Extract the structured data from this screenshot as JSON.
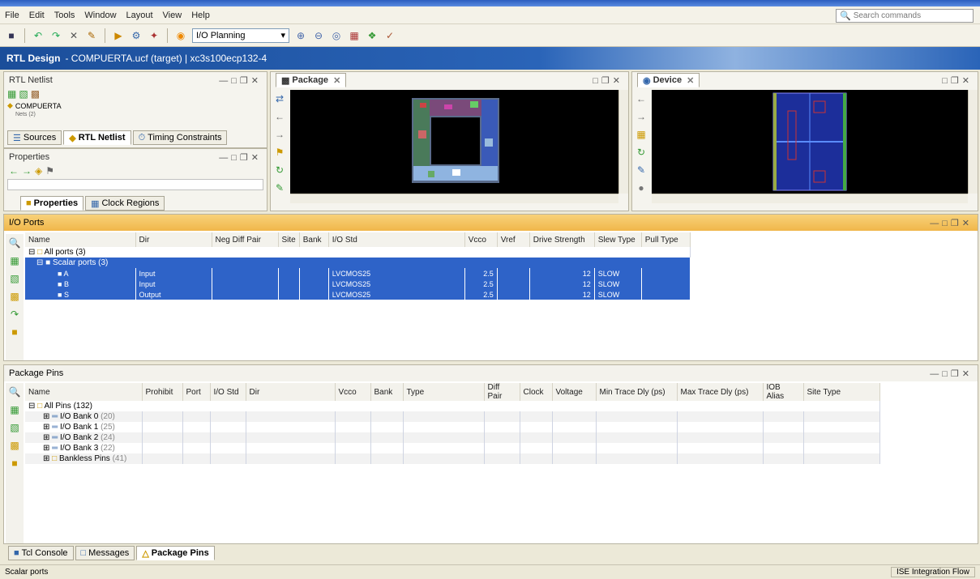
{
  "menu": [
    "File",
    "Edit",
    "Tools",
    "Window",
    "Layout",
    "View",
    "Help"
  ],
  "search_placeholder": "Search commands",
  "toolbar": {
    "layout_value": "I/O Planning"
  },
  "title": {
    "main": "RTL Design",
    "subtitle": "- COMPUERTA.ucf (target) | xc3s100ecp132-4"
  },
  "rtl_netlist": {
    "header": "RTL Netlist",
    "root_item": "COMPUERTA",
    "sub_item": "Nets (2)",
    "tabs": [
      "Sources",
      "RTL Netlist",
      "Timing Constraints"
    ]
  },
  "properties": {
    "header": "Properties",
    "tabs": [
      "Properties",
      "Clock Regions"
    ]
  },
  "package_view": {
    "tab": "Package"
  },
  "device_view": {
    "tab": "Device"
  },
  "io_ports": {
    "header": "I/O Ports",
    "columns": [
      "Name",
      "Dir",
      "Neg Diff Pair",
      "Site",
      "Bank",
      "I/O Std",
      "Vcco",
      "Vref",
      "Drive Strength",
      "Slew Type",
      "Pull Type"
    ],
    "root": "All ports (3)",
    "group": "Scalar ports (3)",
    "rows": [
      {
        "name": "A",
        "dir": "Input",
        "std": "LVCMOS25",
        "vcco": "2.5",
        "drive": "12",
        "slew": "SLOW"
      },
      {
        "name": "B",
        "dir": "Input",
        "std": "LVCMOS25",
        "vcco": "2.5",
        "drive": "12",
        "slew": "SLOW"
      },
      {
        "name": "S",
        "dir": "Output",
        "std": "LVCMOS25",
        "vcco": "2.5",
        "drive": "12",
        "slew": "SLOW"
      }
    ]
  },
  "package_pins": {
    "header": "Package Pins",
    "columns": [
      "Name",
      "Prohibit",
      "Port",
      "I/O Std",
      "Dir",
      "Vcco",
      "Bank",
      "Type",
      "Diff Pair",
      "Clock",
      "Voltage",
      "Min Trace Dly (ps)",
      "Max Trace Dly (ps)",
      "IOB Alias",
      "Site Type"
    ],
    "root": "All Pins (132)",
    "rows": [
      {
        "name": "I/O Bank 0",
        "count": "(20)"
      },
      {
        "name": "I/O Bank 1",
        "count": "(25)"
      },
      {
        "name": "I/O Bank 2",
        "count": "(24)"
      },
      {
        "name": "I/O Bank 3",
        "count": "(22)"
      },
      {
        "name": "Bankless Pins",
        "count": "(41)"
      }
    ]
  },
  "bottom_tabs": [
    "Tcl Console",
    "Messages",
    "Package Pins"
  ],
  "status": {
    "left": "Scalar ports",
    "right": "ISE Integration Flow"
  }
}
